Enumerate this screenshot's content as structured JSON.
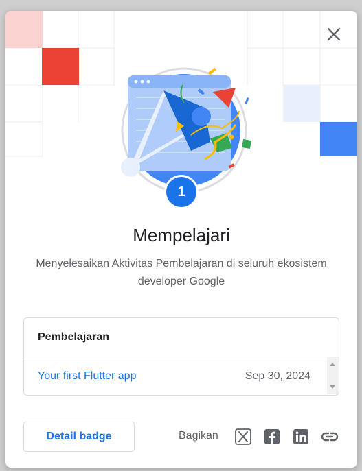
{
  "dialog": {
    "badge_number": "1",
    "title": "Mempelajari",
    "description": "Menyelesaikan Aktivitas Pembelajaran di seluruh ekosistem developer Google",
    "activity_card": {
      "header": "Pembelajaran",
      "items": [
        {
          "name": "Your first Flutter app",
          "date": "Sep 30, 2024"
        }
      ]
    },
    "detail_button_label": "Detail badge",
    "share_label": "Bagikan",
    "share_icons": [
      "x-icon",
      "facebook-icon",
      "linkedin-icon",
      "link-icon"
    ],
    "close_icon": "close-icon"
  },
  "colors": {
    "accent": "#1a73e8",
    "grid_red": "#ea4335",
    "grid_blue": "#4285f4",
    "grid_pale_red": "#fad2cf",
    "grid_pale_blue": "#e8f0fe"
  }
}
